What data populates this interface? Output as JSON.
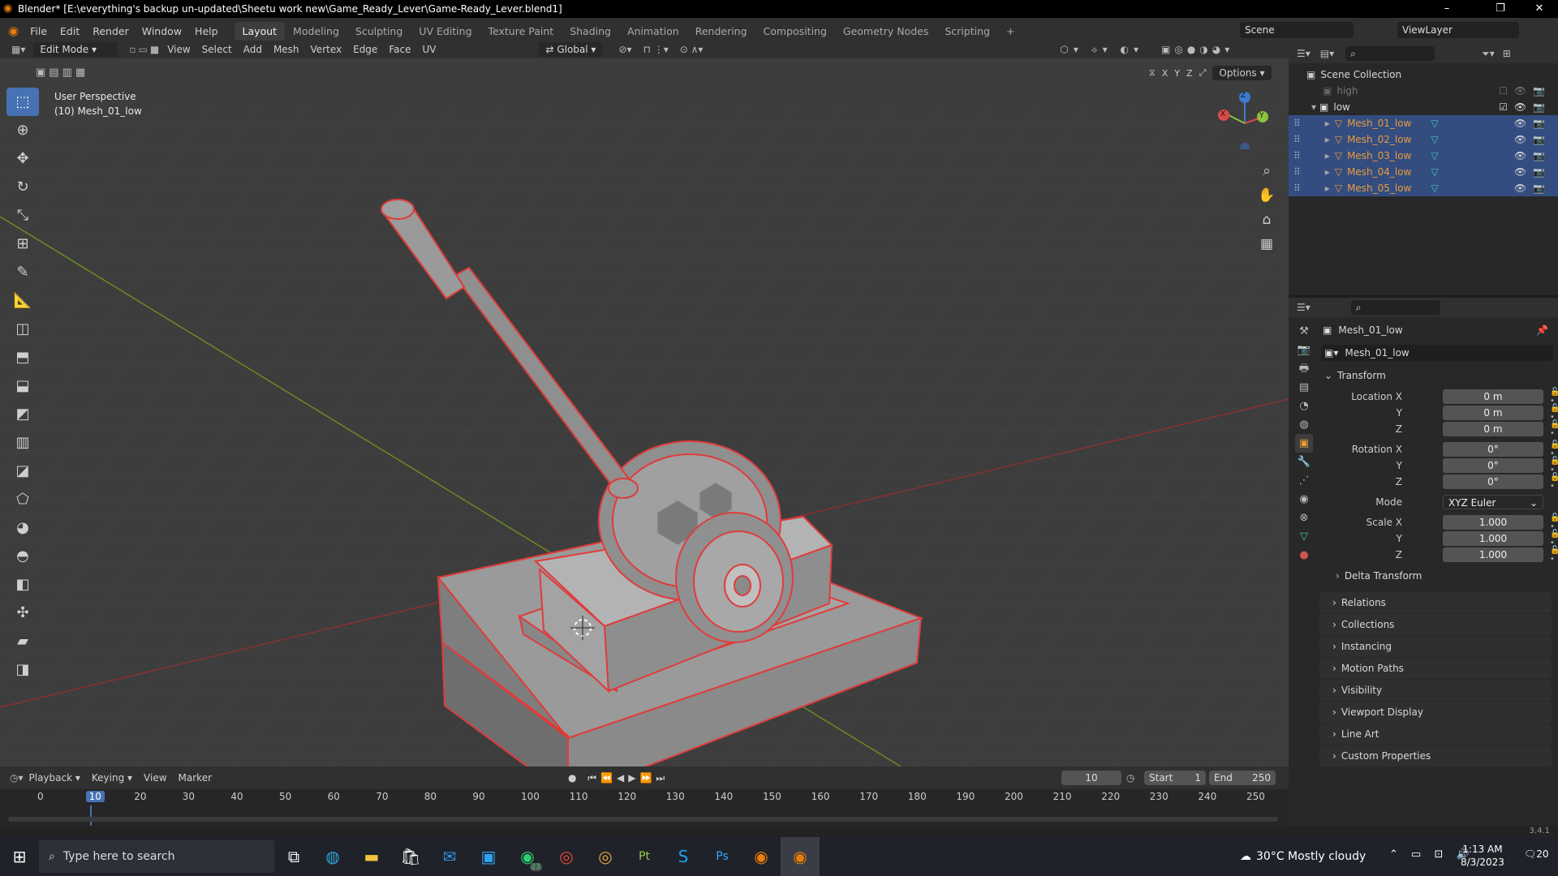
{
  "window": {
    "title": "Blender* [E:\\everything's backup un-updated\\Sheetu work new\\Game_Ready_Lever\\Game-Ready_Lever.blend1]",
    "minimize": "–",
    "maximize": "❐",
    "close": "✕"
  },
  "menu": [
    "File",
    "Edit",
    "Render",
    "Window",
    "Help"
  ],
  "workspaces": [
    "Layout",
    "Modeling",
    "Sculpting",
    "UV Editing",
    "Texture Paint",
    "Shading",
    "Animation",
    "Rendering",
    "Compositing",
    "Geometry Nodes",
    "Scripting"
  ],
  "workspace_add": "+",
  "scene": "Scene",
  "view_layer": "ViewLayer",
  "header": {
    "mode": "Edit Mode",
    "items": [
      "View",
      "Select",
      "Add",
      "Mesh",
      "Vertex",
      "Edge",
      "Face",
      "UV"
    ],
    "orientation": "Global",
    "options": "Options",
    "axes": [
      "X",
      "Y",
      "Z"
    ]
  },
  "viewport": {
    "perspective": "User Perspective",
    "object": "(10) Mesh_01_low",
    "gizmo": {
      "z": "Z",
      "y": "Y",
      "x": "X"
    }
  },
  "outliner": {
    "root": "Scene Collection",
    "collections": [
      {
        "name": "high"
      },
      {
        "name": "low"
      }
    ],
    "objects": [
      "Mesh_01_low",
      "Mesh_02_low",
      "Mesh_03_low",
      "Mesh_04_low",
      "Mesh_05_low"
    ]
  },
  "properties": {
    "object_name": "Mesh_01_low",
    "data_name": "Mesh_01_low",
    "transform_title": "Transform",
    "location": {
      "label": "Location X",
      "x": "0 m",
      "y": "0 m",
      "z": "0 m"
    },
    "rotation": {
      "label": "Rotation X",
      "x": "0°",
      "y": "0°",
      "z": "0°"
    },
    "mode_label": "Mode",
    "mode": "XYZ Euler",
    "scale": {
      "label": "Scale X",
      "x": "1.000",
      "y": "1.000",
      "z": "1.000"
    },
    "axis_y": "Y",
    "axis_z": "Z",
    "delta": "Delta Transform",
    "panels": [
      "Relations",
      "Collections",
      "Instancing",
      "Motion Paths",
      "Visibility",
      "Viewport Display",
      "Line Art",
      "Custom Properties"
    ]
  },
  "timeline": {
    "menus": [
      "Playback",
      "Keying",
      "View",
      "Marker"
    ],
    "current_frame": "10",
    "start_label": "Start",
    "start": "1",
    "end_label": "End",
    "end": "250",
    "ticks": [
      "0",
      "10",
      "20",
      "30",
      "40",
      "50",
      "60",
      "70",
      "80",
      "90",
      "100",
      "110",
      "120",
      "130",
      "140",
      "150",
      "160",
      "170",
      "180",
      "190",
      "200",
      "210",
      "220",
      "230",
      "240",
      "250"
    ]
  },
  "version": "3.4.1",
  "taskbar": {
    "search_placeholder": "Type here to search",
    "weather": "30°C  Mostly cloudy",
    "time": "1:13 AM",
    "date": "8/3/2023",
    "notifications": "20",
    "whatsapp_badge": "23"
  },
  "colors": {
    "accent": "#4772b3",
    "selection_edge": "#e03c3c",
    "object_orange": "#e99a3c"
  }
}
